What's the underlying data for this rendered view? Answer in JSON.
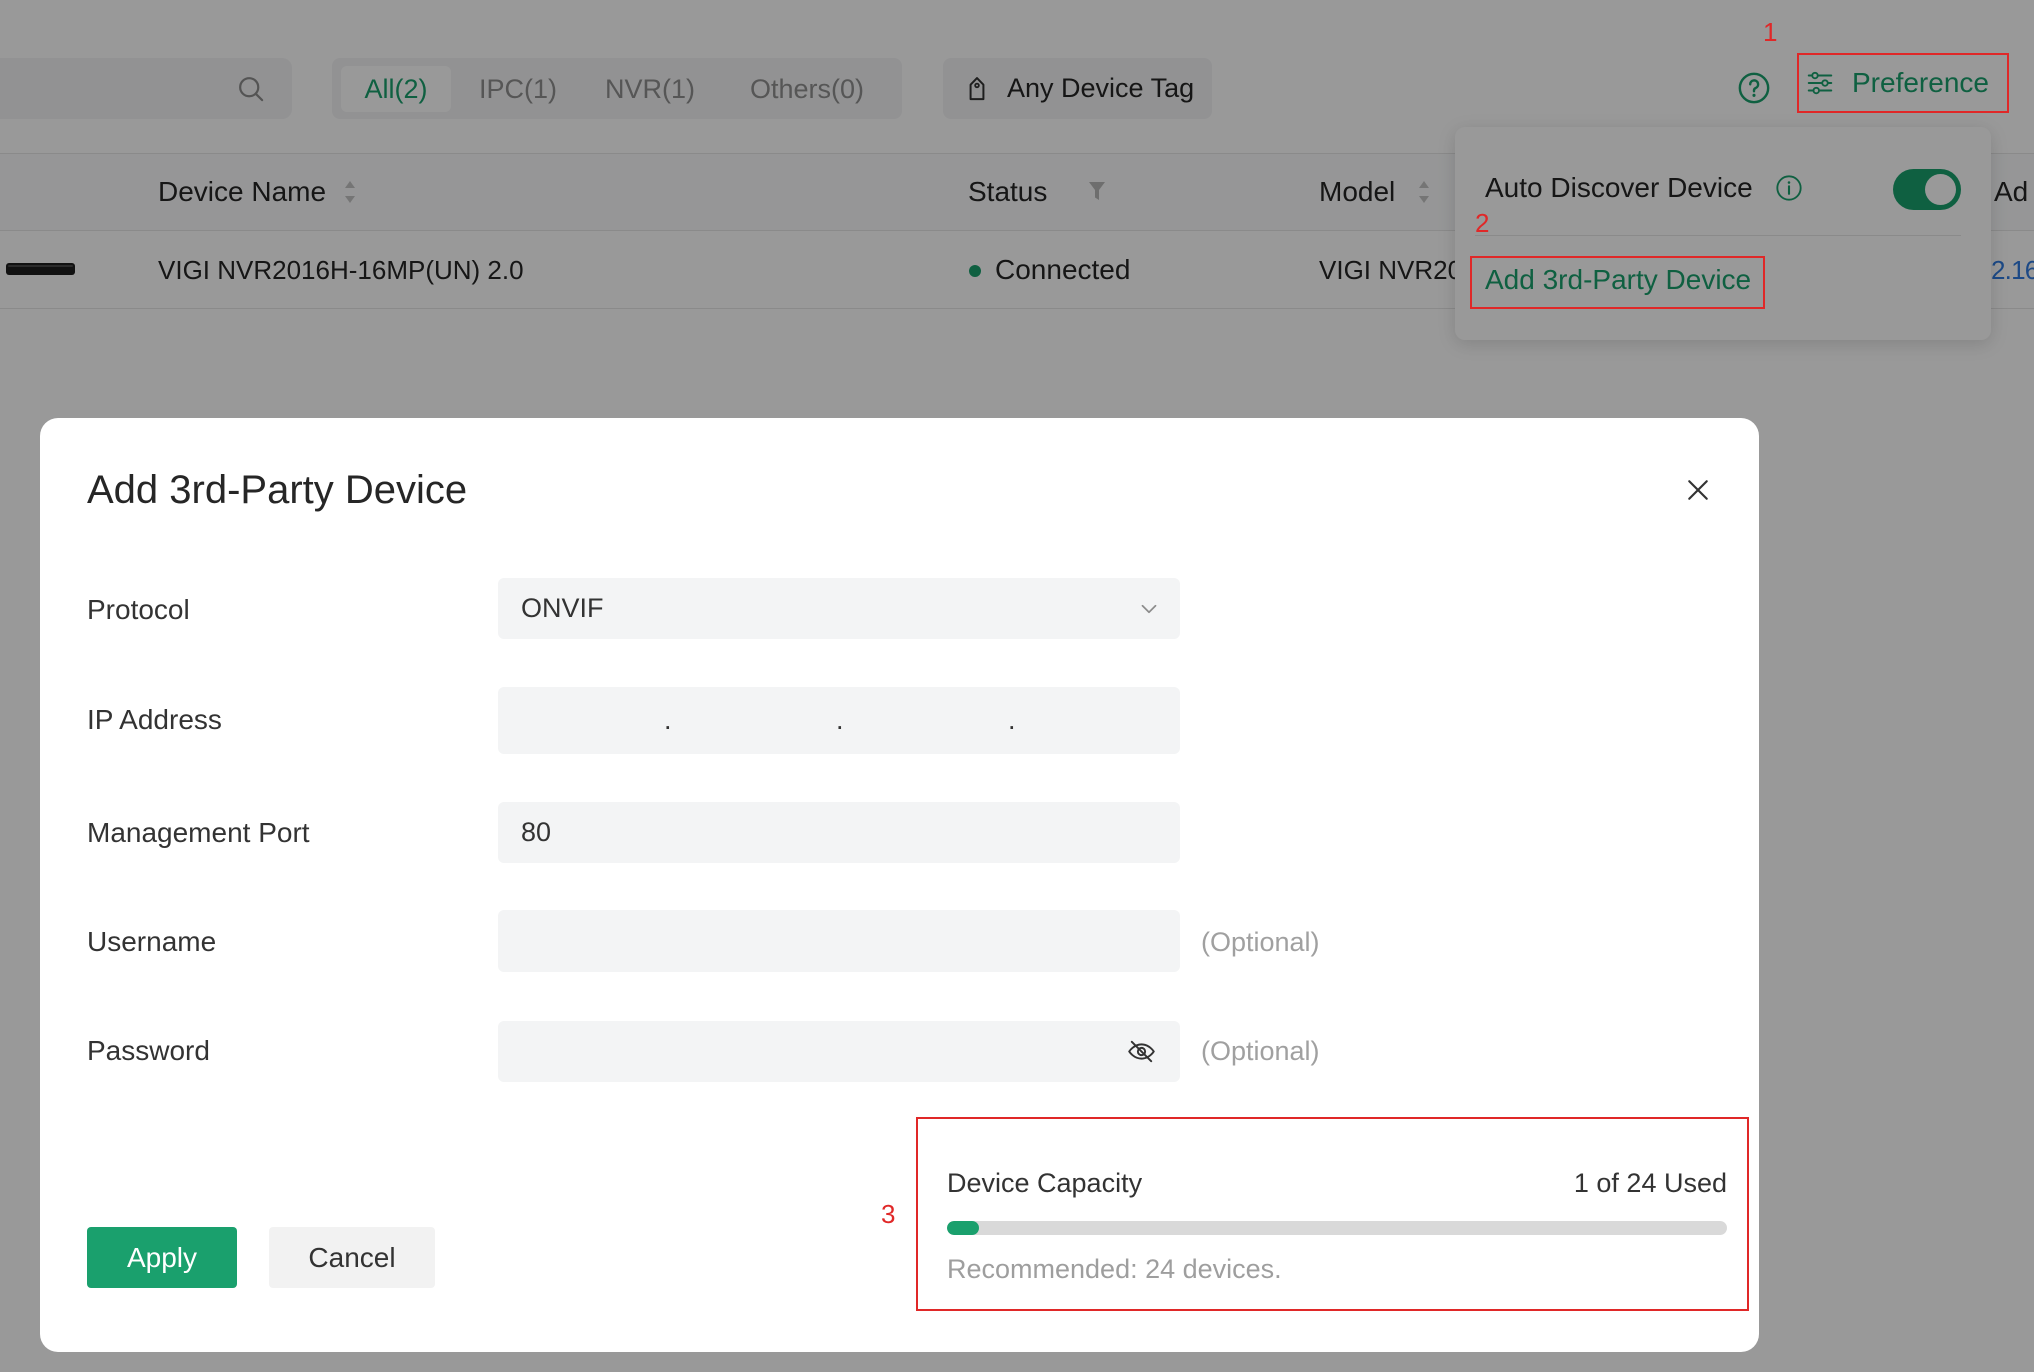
{
  "colors": {
    "accent": "#1aa06d",
    "annotation": "#e02828",
    "link": "#2f7be0"
  },
  "icons": {
    "search": "search-icon",
    "tag": "tag-icon",
    "help": "help-icon",
    "preference": "sliders-icon",
    "sort": "sort-icon",
    "filter": "filter-icon",
    "info": "info-icon",
    "close": "close-icon",
    "protocol_dropdown": "chevron-down-icon",
    "password_visibility": "eye-off-icon"
  },
  "toolbar": {
    "tabs": [
      {
        "label": "All(2)",
        "selected": true
      },
      {
        "label": "IPC(1)",
        "selected": false
      },
      {
        "label": "NVR(1)",
        "selected": false
      },
      {
        "label": "Others(0)",
        "selected": false
      }
    ],
    "tag_filter_label": "Any Device Tag",
    "preference_label": "Preference"
  },
  "table": {
    "columns": [
      "Device Name",
      "Status",
      "Model",
      "Ad"
    ],
    "rows": [
      {
        "device_name": "VIGI NVR2016H-16MP(UN) 2.0",
        "status": "Connected",
        "model": "VIGI NVR20",
        "address": "2.16"
      }
    ]
  },
  "preference_menu": {
    "auto_discover_label": "Auto Discover Device",
    "auto_discover_enabled": true,
    "add_third_party_label": "Add 3rd-Party Device"
  },
  "dialog": {
    "title": "Add 3rd-Party Device",
    "protocol": {
      "label": "Protocol",
      "value": "ONVIF"
    },
    "ip_address": {
      "label": "IP Address",
      "octets": [
        "",
        "",
        "",
        ""
      ],
      "separator": "."
    },
    "management_port": {
      "label": "Management Port",
      "value": "80"
    },
    "username": {
      "label": "Username",
      "value": "",
      "hint": "(Optional)"
    },
    "password": {
      "label": "Password",
      "value": "",
      "hint": "(Optional)"
    },
    "capacity": {
      "label": "Device Capacity",
      "usage_text": "1 of 24 Used",
      "used": 1,
      "total": 24,
      "note": "Recommended: 24 devices."
    },
    "apply_label": "Apply",
    "cancel_label": "Cancel"
  },
  "annotations": {
    "step1": "1",
    "step2": "2",
    "step3": "3"
  }
}
